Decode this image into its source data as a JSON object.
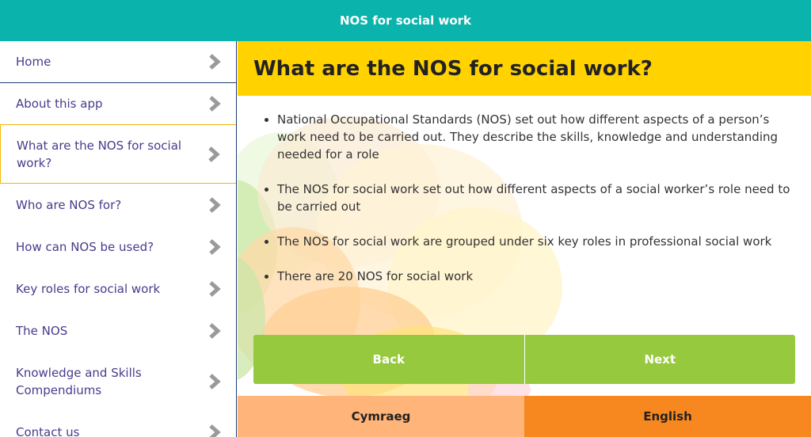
{
  "header": {
    "title": "NOS for social work"
  },
  "sidebar": {
    "items": [
      {
        "label": "Home",
        "active": false
      },
      {
        "label": "About this app",
        "active": false
      },
      {
        "label": "What are the NOS for social work?",
        "active": true
      },
      {
        "label": "Who are NOS for?",
        "active": false
      },
      {
        "label": "How can NOS be used?",
        "active": false
      },
      {
        "label": "Key roles for social work",
        "active": false
      },
      {
        "label": "The NOS",
        "active": false
      },
      {
        "label": "Knowledge and Skills Compendiums",
        "active": false
      },
      {
        "label": "Contact us",
        "active": false
      }
    ]
  },
  "main": {
    "title": "What are the NOS for social work?",
    "bullets": [
      "National Occupational Standards (NOS) set out how different aspects of a person’s work need to be carried out. They describe the skills, knowledge and understanding needed for a role",
      "The NOS for social work set out how different aspects of a social worker’s role need to be carried out",
      "The NOS for social work are grouped under six key roles in professional social work",
      "There are 20 NOS for social work"
    ],
    "back_label": "Back",
    "next_label": "Next"
  },
  "language": {
    "welsh_label": "Cymraeg",
    "english_label": "English"
  },
  "colors": {
    "header": "#0ab3ab",
    "title_band": "#ffd200",
    "button": "#96c93d",
    "welsh_tab": "#ffb47a",
    "english_tab": "#f7871f",
    "nav_text": "#4a3a8c"
  },
  "icons": {
    "nav_arrow": "chevron-right-icon"
  }
}
